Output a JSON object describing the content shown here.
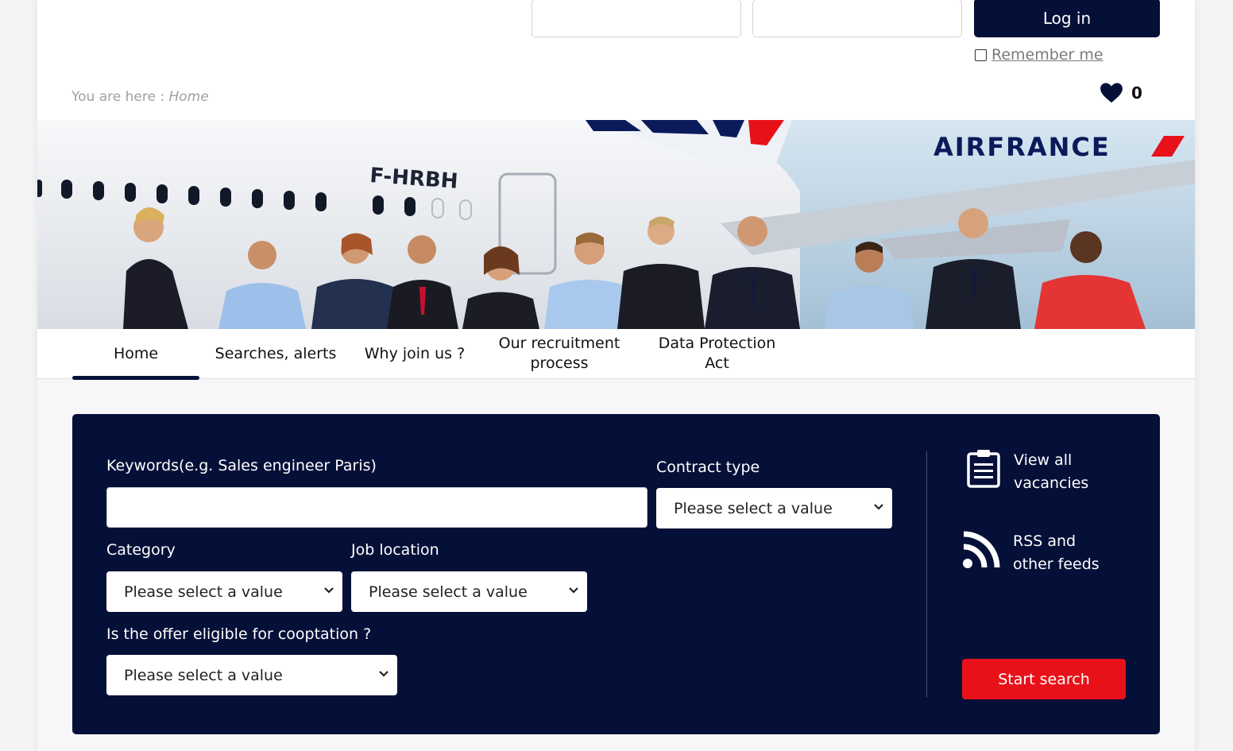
{
  "login": {
    "username_value": "",
    "password_value": "",
    "button_label": "Log in",
    "remember_label": "Remember me",
    "remember_checked": false
  },
  "breadcrumb": {
    "prefix": "You are here :",
    "current": "Home"
  },
  "favorites": {
    "count": "0"
  },
  "banner": {
    "brand": "AIRFRANCE",
    "registration": "F-HRBH"
  },
  "nav": {
    "items": [
      {
        "label": "Home",
        "active": true
      },
      {
        "label": "Searches, alerts",
        "active": false
      },
      {
        "label": "Why join us ?",
        "active": false
      },
      {
        "label": "Our recruitment process",
        "active": false
      },
      {
        "label": "Data Protection Act",
        "active": false
      }
    ]
  },
  "search": {
    "keywords_label": "Keywords(e.g. Sales engineer Paris)",
    "keywords_value": "",
    "contract_label": "Contract type",
    "contract_value": "Please select a value",
    "category_label": "Category",
    "category_value": "Please select a value",
    "location_label": "Job location",
    "location_value": "Please select a value",
    "cooptation_label": "Is the offer eligible for cooptation ?",
    "cooptation_value": "Please select a value",
    "view_all_label": "View all vacancies",
    "rss_label": "RSS and other feeds",
    "start_button": "Start search"
  },
  "colors": {
    "navy": "#051038",
    "red": "#e8111a",
    "white": "#ffffff"
  }
}
